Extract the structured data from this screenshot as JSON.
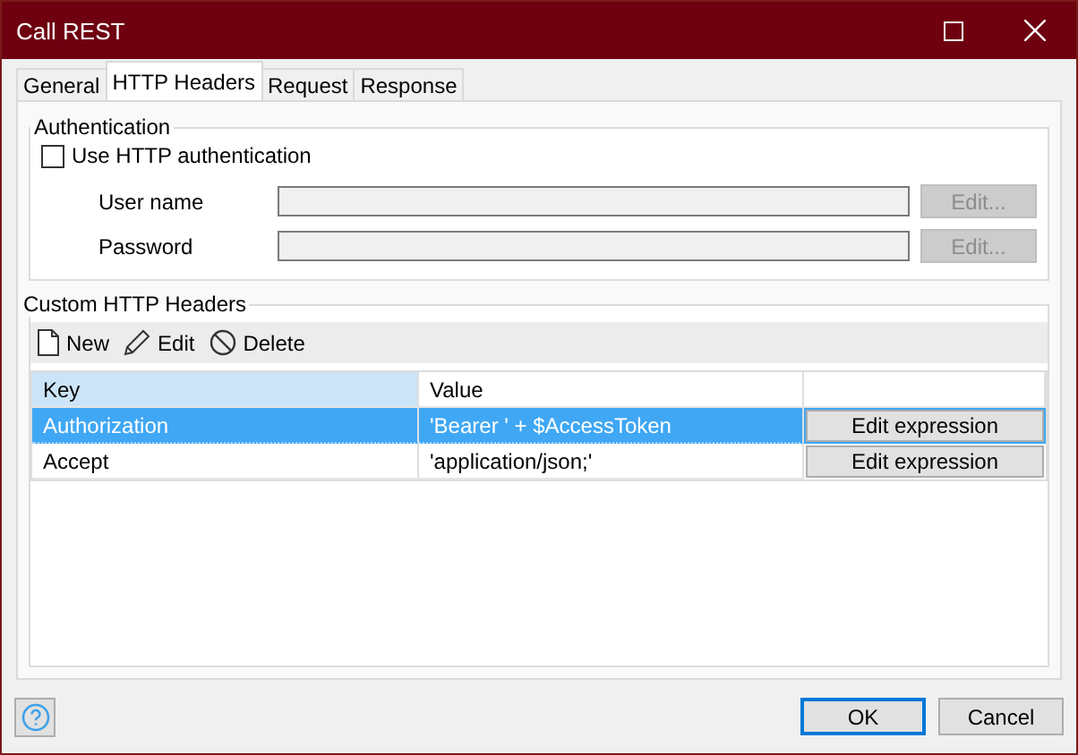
{
  "window": {
    "title": "Call REST"
  },
  "tabs": [
    {
      "label": "General",
      "selected": false
    },
    {
      "label": "HTTP Headers",
      "selected": true
    },
    {
      "label": "Request",
      "selected": false
    },
    {
      "label": "Response",
      "selected": false
    }
  ],
  "authentication": {
    "title": "Authentication",
    "checkbox": {
      "label": "Use HTTP authentication",
      "checked": false
    },
    "fields": [
      {
        "label": "User name",
        "button": "Edit...",
        "disabled": true
      },
      {
        "label": "Password",
        "button": "Edit...",
        "disabled": true
      }
    ]
  },
  "custom_headers": {
    "title": "Custom HTTP Headers",
    "toolbar": [
      {
        "kind": "new",
        "label": "New"
      },
      {
        "kind": "edit",
        "label": "Edit"
      },
      {
        "kind": "delete",
        "label": "Delete"
      }
    ],
    "columns": [
      "Key",
      "Value"
    ],
    "rows": [
      {
        "key": "Authorization",
        "value": "'Bearer ' + $AccessToken",
        "button": "Edit expression",
        "selected": true
      },
      {
        "key": "Accept",
        "value": "'application/json;'",
        "button": "Edit expression",
        "selected": false
      }
    ]
  },
  "buttons": [
    {
      "label": "OK",
      "default": true
    },
    {
      "label": "Cancel",
      "default": false
    }
  ]
}
